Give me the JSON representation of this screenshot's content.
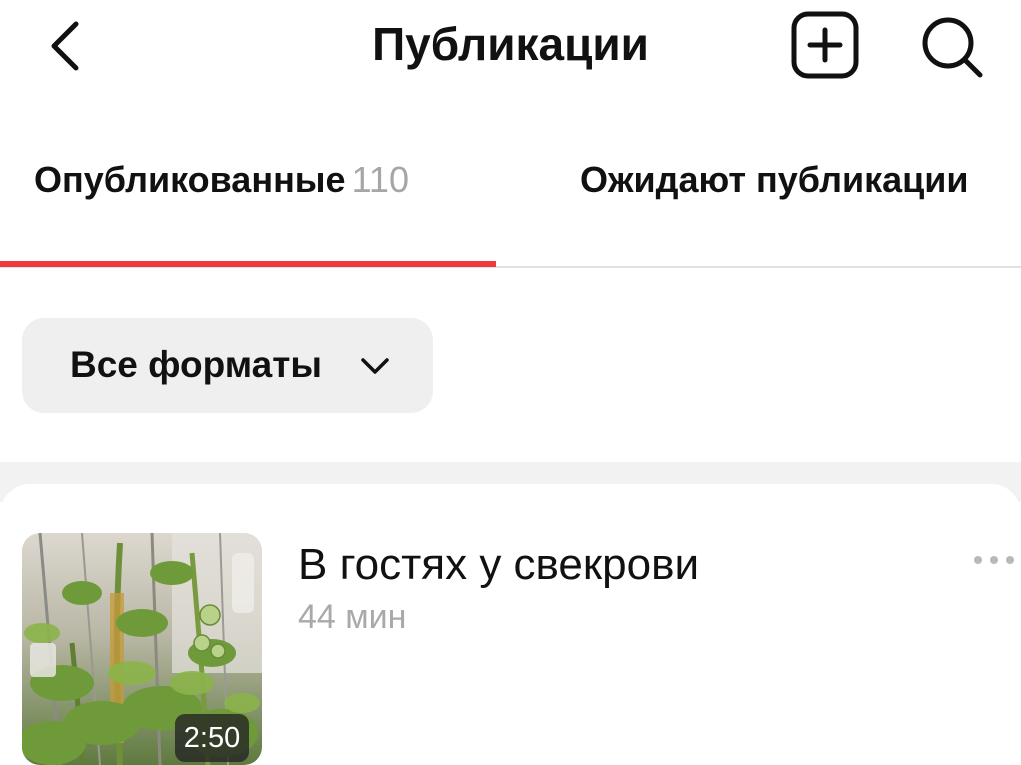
{
  "header": {
    "title": "Публикации",
    "icons": {
      "back": "chevron-left-icon",
      "add": "plus-square-icon",
      "search": "search-icon"
    }
  },
  "tabs": [
    {
      "label": "Опубликованные",
      "count": "110",
      "active": true
    },
    {
      "label": "Ожидают публикации",
      "active": false
    }
  ],
  "colors": {
    "accent": "#ef3b3b",
    "muted": "#a6a6a6",
    "chip_bg": "#efefef"
  },
  "filter": {
    "label": "Все форматы",
    "icon": "chevron-down-icon"
  },
  "posts": [
    {
      "title": "В гостях у свекрови",
      "time": "44 мин",
      "duration": "2:50",
      "more_icon": "more-horizontal-icon"
    }
  ]
}
